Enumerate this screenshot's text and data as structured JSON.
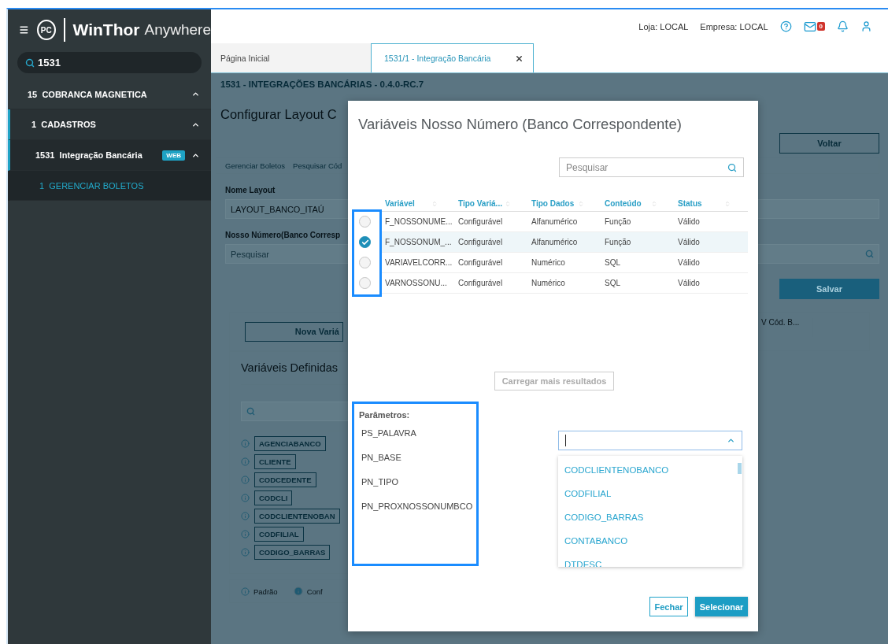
{
  "sidebar": {
    "logo": {
      "mark": "PC",
      "brand": "WinThor",
      "suffix": "Anywhere"
    },
    "search": {
      "value": "1531"
    },
    "menu": [
      {
        "code": "15",
        "label": "COBRANCA MAGNETICA",
        "expanded": true,
        "children": [
          {
            "code": "1",
            "label": "CADASTROS",
            "expanded": true,
            "children": [
              {
                "code": "1531",
                "label": "Integração Bancária",
                "badge": "WEB",
                "expanded": true,
                "children": [
                  {
                    "code": "1",
                    "label": "GERENCIAR BOLETOS",
                    "selected": true
                  }
                ]
              }
            ]
          }
        ]
      }
    ]
  },
  "header": {
    "store": "Loja: LOCAL",
    "company": "Empresa: LOCAL",
    "mail_count": "0"
  },
  "tabs": [
    {
      "label": "Página Inicial",
      "selected": false,
      "closable": false
    },
    {
      "label": "1531/1 - Integração Bancária",
      "selected": true,
      "closable": true
    }
  ],
  "page": {
    "title": "1531 - INTEGRAÇÕES BANCÁRIAS - 0.4.0-RC.7",
    "heading": "Configurar Layout C",
    "back_button": "Voltar",
    "breadcrumbs": [
      "Gerenciar Boletos",
      "Pesquisar Cód"
    ],
    "layout_name": {
      "label": "Nome Layout",
      "value": "LAYOUT_BANCO_ITAÚ"
    },
    "nosso_numero": {
      "label": "Nosso Número(Banco Corresp",
      "placeholder": "Pesquisar"
    },
    "save_button": "Salvar",
    "new_variable_button": "Nova Variá",
    "column_header": "V Cód. B...",
    "defined": {
      "title": "Variáveis Definidas",
      "tags": [
        "AGENCIABANCO",
        "CLIENTE",
        "CODCEDENTE",
        "CODCLI",
        "CODCLIENTENOBAN",
        "CODFILIAL",
        "CODIGO_BARRAS"
      ]
    },
    "legend": [
      {
        "kind": "outline",
        "label": "Padrão"
      },
      {
        "kind": "filled",
        "label": "Conf"
      }
    ]
  },
  "modal": {
    "title": "Variáveis Nosso Número (Banco Correspondente)",
    "search": {
      "placeholder": "Pesquisar"
    },
    "columns": [
      "Variável",
      "Tipo Variá...",
      "Tipo Dados",
      "Conteúdo",
      "Status"
    ],
    "rows": [
      {
        "cells": [
          "F_NOSSONUME...",
          "Configurável",
          "Alfanumérico",
          "Função",
          "Válido"
        ],
        "selected": false
      },
      {
        "cells": [
          "F_NOSSONUM_...",
          "Configurável",
          "Alfanumérico",
          "Função",
          "Válido"
        ],
        "selected": true
      },
      {
        "cells": [
          "VARIAVELCORR...",
          "Configurável",
          "Numérico",
          "SQL",
          "Válido"
        ],
        "selected": false
      },
      {
        "cells": [
          "VARNOSSONU...",
          "Configurável",
          "Numérico",
          "SQL",
          "Válido"
        ],
        "selected": false
      }
    ],
    "load_more_button": "Carregar mais resultados",
    "parameters": {
      "title": "Parâmetros:",
      "items": [
        "PS_PALAVRA",
        "PN_BASE",
        "PN_TIPO",
        "PN_PROXNOSSONUMBCO"
      ]
    },
    "options": [
      "CODCLIENTENOBANCO",
      "CODFILIAL",
      "CODIGO_BARRAS",
      "CONTABANCO",
      "DTDESC"
    ],
    "close_button": "Fechar",
    "select_button": "Selecionar"
  }
}
